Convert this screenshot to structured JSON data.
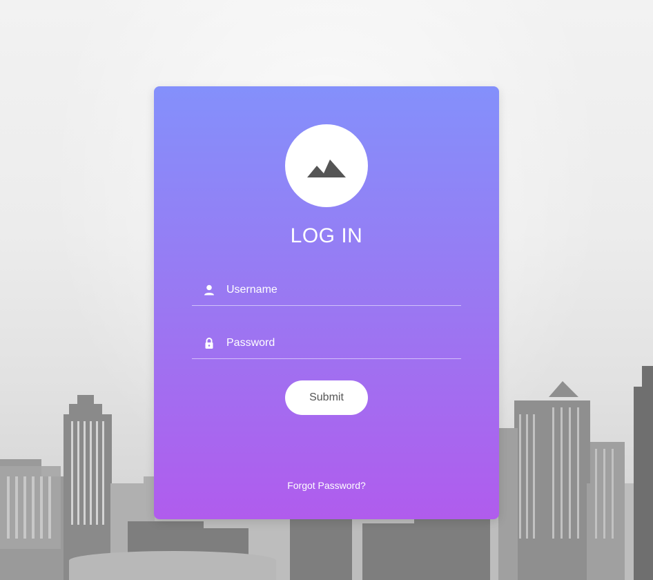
{
  "login_form": {
    "logo_icon": "mountain-icon",
    "title": "LOG IN",
    "username": {
      "icon": "person-icon",
      "placeholder": "Username",
      "value": ""
    },
    "password": {
      "icon": "lock-icon",
      "placeholder": "Password",
      "value": ""
    },
    "submit_label": "Submit",
    "forgot_link": "Forgot Password?"
  },
  "colors": {
    "card_gradient_top": "#8490fb",
    "card_gradient_bottom": "#b05ced",
    "button_bg": "#ffffff",
    "button_text": "#555555",
    "text": "#ffffff"
  }
}
